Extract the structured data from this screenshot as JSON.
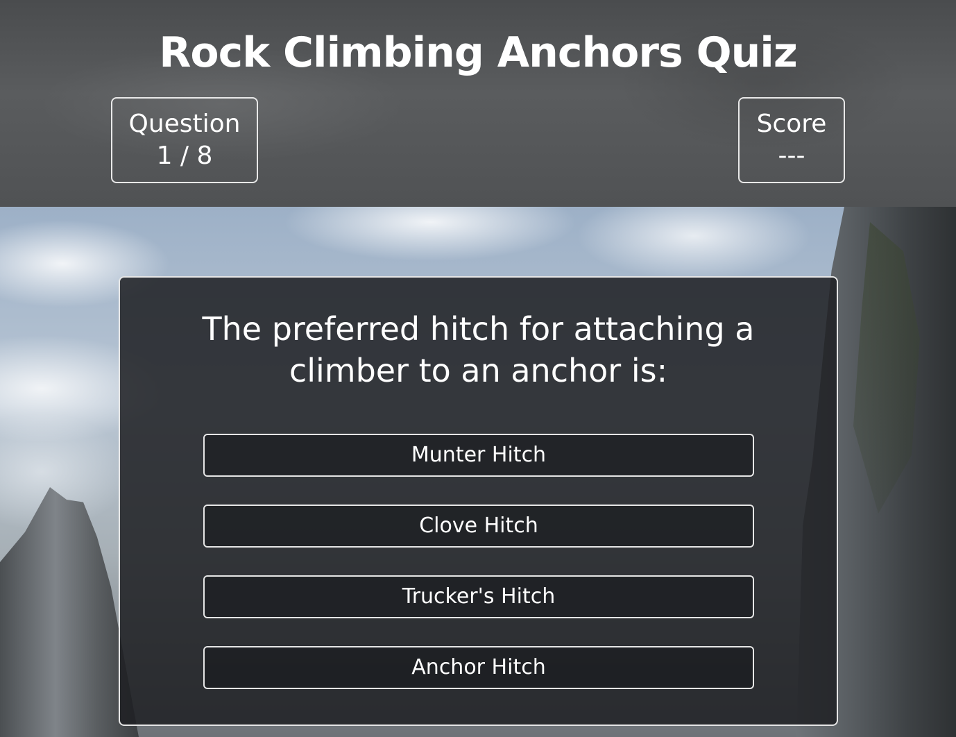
{
  "header": {
    "title": "Rock Climbing Anchors Quiz"
  },
  "stats": {
    "question_label": "Question",
    "question_value": "1 / 8",
    "score_label": "Score",
    "score_value": "---"
  },
  "quiz": {
    "question": "The preferred hitch for attaching a climber to an anchor is:",
    "answers": [
      "Munter Hitch",
      "Clove Hitch",
      "Trucker's Hitch",
      "Anchor Hitch"
    ]
  },
  "colors": {
    "header_overlay": "#505254",
    "card_background": "#1e2023",
    "border": "#e6e6e6",
    "text": "#ffffff"
  }
}
